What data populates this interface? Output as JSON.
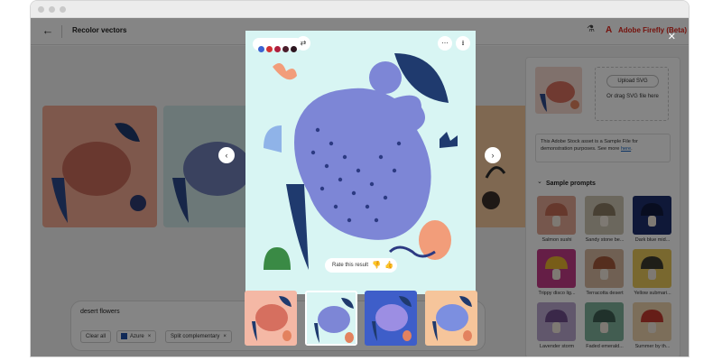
{
  "window": {
    "app_title": "Recolor vectors",
    "brand_name": "Adobe Firefly (Beta)"
  },
  "upload": {
    "button_label": "Upload SVG",
    "drag_text": "Or drag SVG file here"
  },
  "sample_notice": {
    "text": "This Adobe Stock asset is a Sample File for demonstration purposes. See more",
    "link": "here",
    "link_suffix": "."
  },
  "sample_prompts": {
    "heading": "Sample prompts",
    "items": [
      {
        "label": "Salmon sushi",
        "bg": "#e2a795",
        "cap": "#c46b55"
      },
      {
        "label": "Sandy stone be...",
        "bg": "#cdc5b3",
        "cap": "#8a7b63"
      },
      {
        "label": "Dark blue mid...",
        "bg": "#1e2f6b",
        "cap": "#10193e"
      },
      {
        "label": "Trippy disco lig...",
        "bg": "#c23b86",
        "cap": "#e6b22e"
      },
      {
        "label": "Terracotta desert",
        "bg": "#d7b9a0",
        "cap": "#a4583a"
      },
      {
        "label": "Yellow submari...",
        "bg": "#e9c75b",
        "cap": "#3d3a2f"
      },
      {
        "label": "Lavender storm",
        "bg": "#bba7cf",
        "cap": "#6f4e8c"
      },
      {
        "label": "Faded emerald...",
        "bg": "#7fb29b",
        "cap": "#3f5e53"
      },
      {
        "label": "Summer by th...",
        "bg": "#edd3ac",
        "cap": "#c33b2e"
      }
    ]
  },
  "prompt": {
    "text": "desert flowers",
    "clear_label": "Clear all",
    "chips": [
      {
        "label": "Azure",
        "swatch": "#1f4fa8"
      },
      {
        "label": "Split complementary",
        "swatch": ""
      }
    ]
  },
  "modal": {
    "palette": [
      "#3b63d1",
      "#d13232",
      "#b01e3c",
      "#4b1d2b",
      "#2d1620"
    ],
    "rate_label": "Rate this result",
    "bg": "#d8f5f3",
    "cat_color": "#7d86d6",
    "dot_color": "#2c3a82"
  },
  "variations": [
    {
      "bg": "#f4b8a5",
      "cat": "#d66f5f"
    },
    {
      "bg": "#d8f5f3",
      "cat": "#7d86d6"
    },
    {
      "bg": "#3e5ec9",
      "cat": "#9c8ee3"
    },
    {
      "bg": "#f6c59b",
      "cat": "#7c8fe0"
    }
  ],
  "background_cards": [
    {
      "bg": "#f1a992",
      "cat": "#c96b5a"
    },
    {
      "bg": "#cfe6e6",
      "cat": "#6f7fb7"
    },
    {
      "bg": "#f4c89c",
      "cat": "#b97352"
    }
  ],
  "colors": {
    "adobe_red": "#e1251b",
    "link_blue": "#1765c0"
  }
}
